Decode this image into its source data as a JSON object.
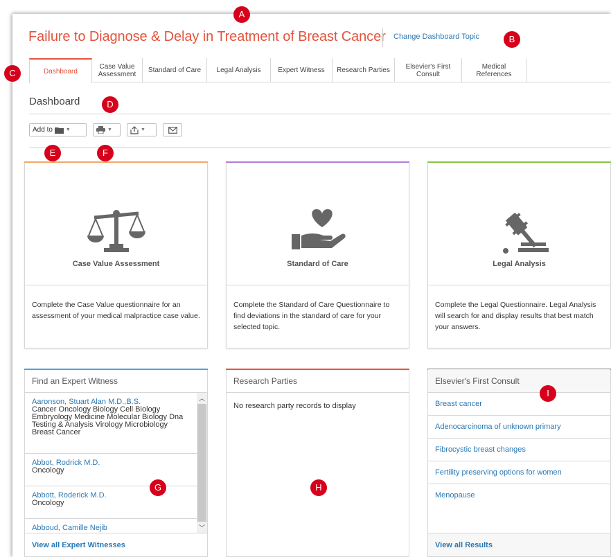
{
  "header": {
    "title": "Failure to Diagnose & Delay in Treatment of Breast Cancer",
    "change_topic": "Change Dashboard Topic"
  },
  "tabs": [
    {
      "label": "Dashboard",
      "active": true
    },
    {
      "label": "Case Value Assessment"
    },
    {
      "label": "Standard of Care"
    },
    {
      "label": "Legal Analysis"
    },
    {
      "label": "Expert Witness"
    },
    {
      "label": "Research Parties"
    },
    {
      "label": "Elsevier's First Consult"
    },
    {
      "label": "Medical References"
    }
  ],
  "section_title": "Dashboard",
  "toolbar": {
    "add_to": "Add to",
    "icons": [
      "folder-icon",
      "print-icon",
      "export-icon",
      "email-icon"
    ]
  },
  "cards": [
    {
      "title": "Case Value Assessment",
      "icon": "scales-icon",
      "accent": "#f0a868",
      "description": "Complete the Case Value questionnaire for an assessment of your medical malpractice case value."
    },
    {
      "title": "Standard of Care",
      "icon": "heart-hand-icon",
      "accent": "#b57bd1",
      "description": "Complete the Standard of Care Questionnaire to find deviations in the standard of care for your selected topic."
    },
    {
      "title": "Legal Analysis",
      "icon": "gavel-icon",
      "accent": "#8cc63f",
      "description": "Complete the Legal Questionnaire. Legal Analysis will search for and display results that best match your answers."
    }
  ],
  "expert_panel": {
    "title": "Find an Expert Witness",
    "accent": "#4aa3df",
    "experts": [
      {
        "name": "Aaronson, Stuart Alan M.D.,B.S.",
        "specialty": "Cancer Oncology Biology Cell Biology Embryology Medicine Molecular Biology Dna Testing & Analysis Virology Microbiology Breast Cancer"
      },
      {
        "name": "Abbot, Rodrick M.D.",
        "specialty": "Oncology"
      },
      {
        "name": "Abbott, Roderick M.D.",
        "specialty": "Oncology"
      },
      {
        "name": "Abboud, Camille Nejib",
        "specialty": ""
      }
    ],
    "footer": "View all Expert Witnesses"
  },
  "research_panel": {
    "title": "Research Parties",
    "accent": "#e4543f",
    "empty_message": "No research party records to display"
  },
  "consult_panel": {
    "title": "Elsevier's First Consult",
    "accent": "#888888",
    "items": [
      "Breast cancer",
      "Adenocarcinoma of unknown primary",
      "Fibrocystic breast changes",
      "Fertility preserving options for women",
      "Menopause"
    ],
    "footer": "View all Results"
  },
  "callouts": [
    "A",
    "B",
    "C",
    "D",
    "E",
    "F",
    "G",
    "H",
    "I"
  ]
}
